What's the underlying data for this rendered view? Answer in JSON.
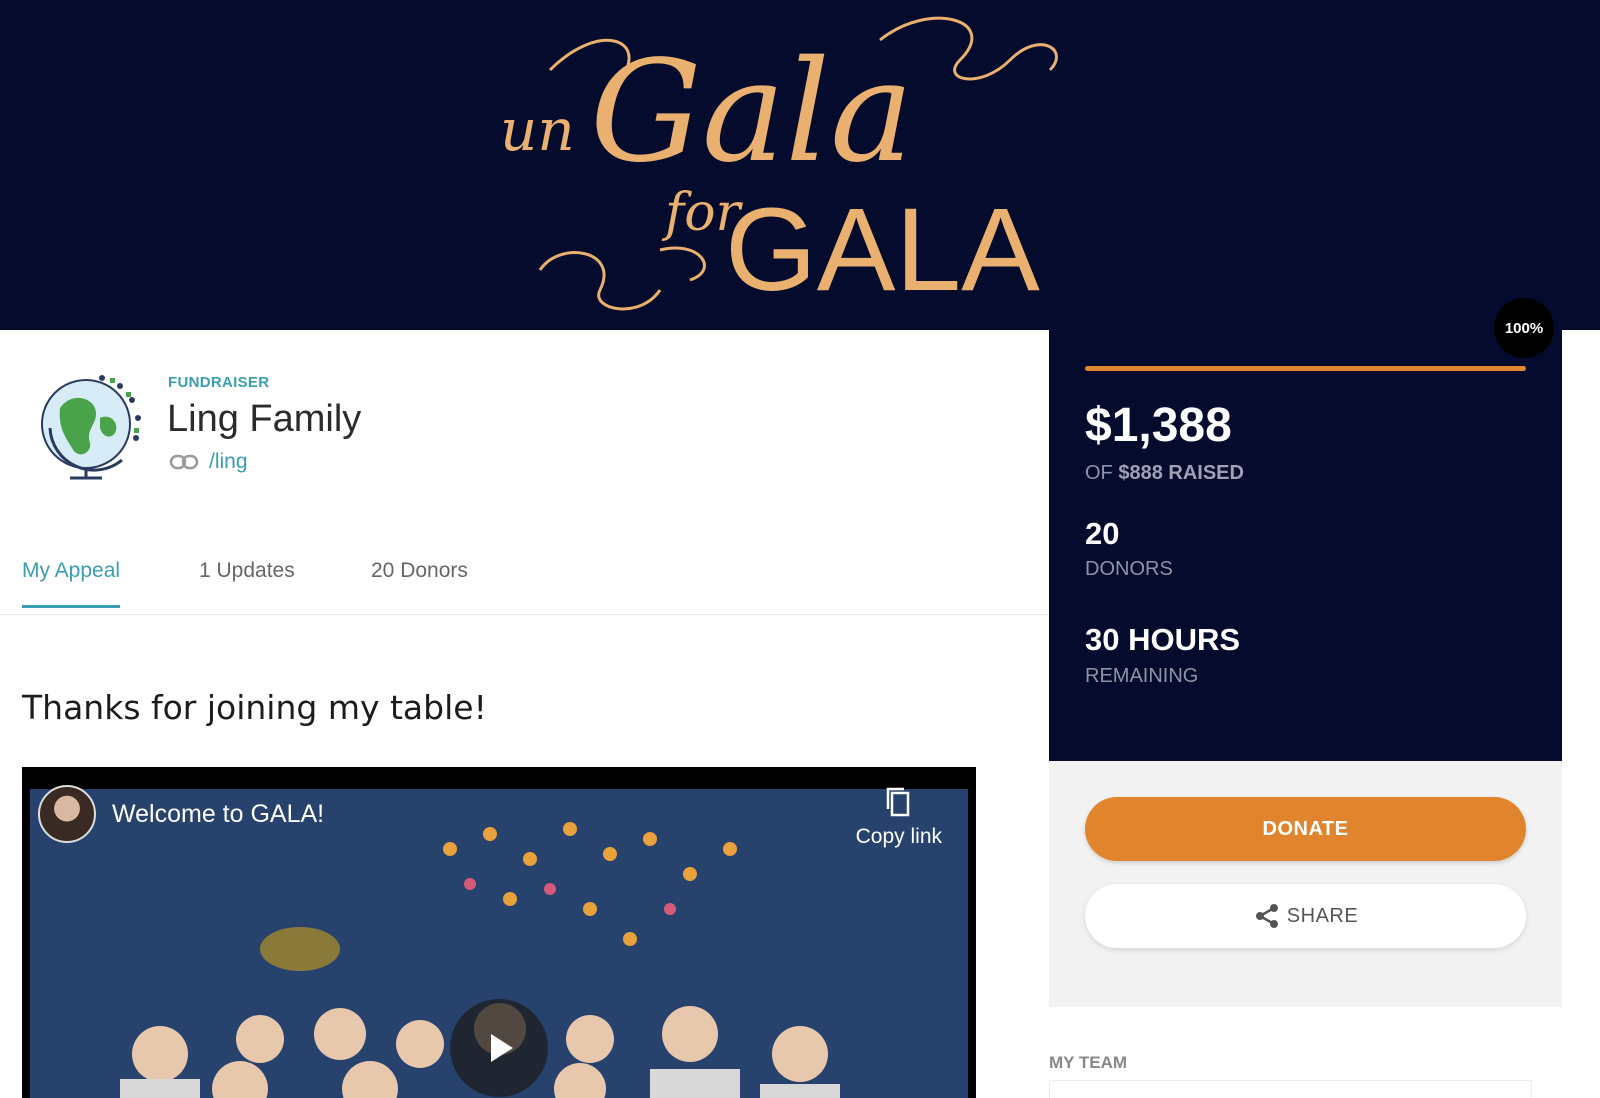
{
  "banner": {
    "logo_text_un": "un",
    "logo_text_gala": "Gala",
    "logo_text_for": "for",
    "logo_text_gala_caps": "GALA"
  },
  "profile": {
    "kicker": "FUNDRAISER",
    "name": "Ling Family",
    "slug": "/ling"
  },
  "tabs": [
    {
      "label": "My Appeal",
      "active": true
    },
    {
      "label": "1 Updates",
      "active": false
    },
    {
      "label": "20 Donors",
      "active": false
    }
  ],
  "appeal": {
    "title": "Thanks for joining my table!",
    "video_title": "Welcome to GALA!",
    "copy_link_label": "Copy link"
  },
  "stats": {
    "badge": "100%",
    "progress_fraction": 1.0,
    "raised": "$1,388",
    "raised_prefix": "OF",
    "goal": "$888 RAISED",
    "donors_count": "20",
    "donors_label": "DONORS",
    "time_remaining": "30 HOURS",
    "time_label": "REMAINING"
  },
  "actions": {
    "donate_label": "DONATE",
    "share_label": "SHARE"
  },
  "team": {
    "label": "MY TEAM"
  },
  "colors": {
    "navy": "#050b2c",
    "gold": "#e9b06f",
    "teal": "#3a9db1",
    "orange": "#e0852e"
  }
}
